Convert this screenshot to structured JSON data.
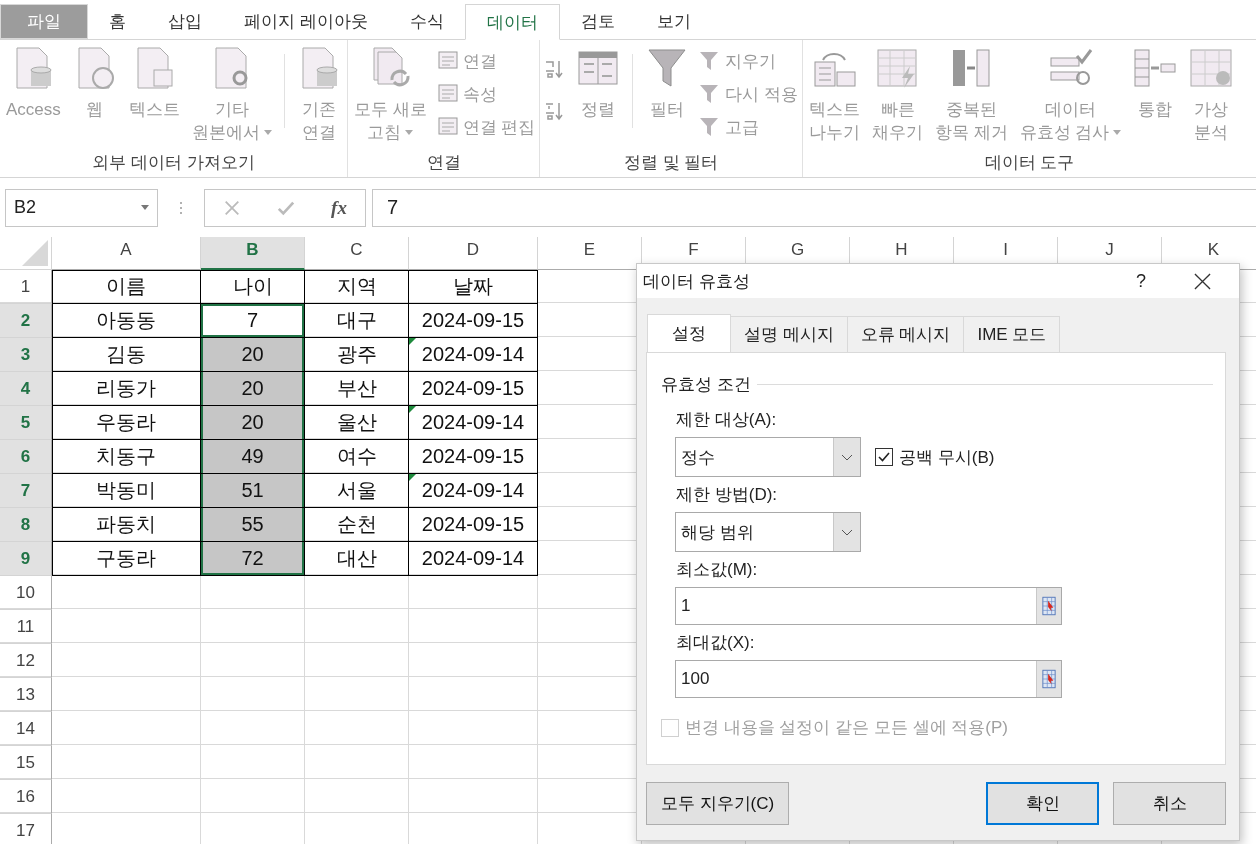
{
  "ribbon_tabs": [
    {
      "label": "파일",
      "kind": "file",
      "selected": false
    },
    {
      "label": "홈",
      "kind": "tab",
      "selected": false
    },
    {
      "label": "삽입",
      "kind": "tab",
      "selected": false
    },
    {
      "label": "페이지 레이아웃",
      "kind": "tab",
      "selected": false
    },
    {
      "label": "수식",
      "kind": "tab",
      "selected": false
    },
    {
      "label": "데이터",
      "kind": "tab",
      "selected": true
    },
    {
      "label": "검토",
      "kind": "tab",
      "selected": false
    },
    {
      "label": "보기",
      "kind": "tab",
      "selected": false
    }
  ],
  "ribbon_groups": [
    {
      "label": "외부 데이터 가져오기",
      "items": [
        {
          "kind": "large",
          "lines": [
            "Access"
          ],
          "dropdown": false
        },
        {
          "kind": "large",
          "lines": [
            "웹"
          ],
          "dropdown": false
        },
        {
          "kind": "large",
          "lines": [
            "텍스트"
          ],
          "dropdown": false
        },
        {
          "kind": "large",
          "lines": [
            "기타",
            "원본에서"
          ],
          "dropdown": true
        },
        {
          "kind": "separator"
        },
        {
          "kind": "large",
          "lines": [
            "기존",
            "연결"
          ],
          "dropdown": false
        }
      ]
    },
    {
      "label": "연결",
      "items": [
        {
          "kind": "large",
          "lines": [
            "모두 새로",
            "고침"
          ],
          "dropdown": true
        },
        {
          "kind": "column",
          "items": [
            {
              "label": "연결"
            },
            {
              "label": "속성"
            },
            {
              "label": "연결 편집"
            }
          ]
        }
      ]
    },
    {
      "label": "정렬 및 필터",
      "items": [
        {
          "kind": "sort_buttons"
        },
        {
          "kind": "large",
          "lines": [
            "정렬"
          ],
          "dropdown": false
        },
        {
          "kind": "separator"
        },
        {
          "kind": "large",
          "lines": [
            "필터"
          ],
          "dropdown": false
        },
        {
          "kind": "column",
          "items": [
            {
              "label": "지우기"
            },
            {
              "label": "다시 적용"
            },
            {
              "label": "고급"
            }
          ]
        }
      ]
    },
    {
      "label": "데이터 도구",
      "items": [
        {
          "kind": "large",
          "lines": [
            "텍스트",
            "나누기"
          ],
          "dropdown": false
        },
        {
          "kind": "large",
          "lines": [
            "빠른",
            "채우기"
          ],
          "dropdown": false
        },
        {
          "kind": "large",
          "lines": [
            "중복된",
            "항목 제거"
          ],
          "dropdown": false
        },
        {
          "kind": "large",
          "lines": [
            "데이터",
            "유효성 검사"
          ],
          "dropdown": true
        },
        {
          "kind": "large",
          "lines": [
            "통합"
          ],
          "dropdown": false
        },
        {
          "kind": "large",
          "lines": [
            "가상",
            "분석"
          ],
          "dropdown": false
        }
      ]
    }
  ],
  "formula_bar": {
    "name_box": "B2",
    "function_button": "fx",
    "value": "7"
  },
  "sheet": {
    "columns": [
      {
        "label": "A",
        "selected": false
      },
      {
        "label": "B",
        "selected": true
      },
      {
        "label": "C",
        "selected": false
      },
      {
        "label": "D",
        "selected": false
      },
      {
        "label": "E",
        "selected": false
      },
      {
        "label": "F",
        "selected": false
      },
      {
        "label": "G",
        "selected": false
      },
      {
        "label": "H",
        "selected": false
      },
      {
        "label": "I",
        "selected": false
      },
      {
        "label": "J",
        "selected": false
      },
      {
        "label": "K",
        "selected": false
      }
    ],
    "rows": [
      {
        "label": "1",
        "selected": false,
        "cells": [
          {
            "text": "이름",
            "selected": false,
            "active": false,
            "flagged": false
          },
          {
            "text": "나이",
            "selected": false,
            "active": false,
            "flagged": false
          },
          {
            "text": "지역",
            "selected": false,
            "active": false,
            "flagged": false
          },
          {
            "text": "날짜",
            "selected": false,
            "active": false,
            "flagged": false
          }
        ]
      },
      {
        "label": "2",
        "selected": true,
        "cells": [
          {
            "text": "아동동",
            "selected": false,
            "active": false,
            "flagged": false
          },
          {
            "text": "7",
            "selected": true,
            "active": true,
            "flagged": false
          },
          {
            "text": "대구",
            "selected": false,
            "active": false,
            "flagged": false
          },
          {
            "text": "2024-09-15",
            "selected": false,
            "active": false,
            "flagged": false
          }
        ]
      },
      {
        "label": "3",
        "selected": true,
        "cells": [
          {
            "text": "김동",
            "selected": false,
            "active": false,
            "flagged": false
          },
          {
            "text": "20",
            "selected": true,
            "active": false,
            "flagged": false
          },
          {
            "text": "광주",
            "selected": false,
            "active": false,
            "flagged": false
          },
          {
            "text": "2024-09-14",
            "selected": false,
            "active": false,
            "flagged": true
          }
        ]
      },
      {
        "label": "4",
        "selected": true,
        "cells": [
          {
            "text": "리동가",
            "selected": false,
            "active": false,
            "flagged": false
          },
          {
            "text": "20",
            "selected": true,
            "active": false,
            "flagged": false
          },
          {
            "text": "부산",
            "selected": false,
            "active": false,
            "flagged": false
          },
          {
            "text": "2024-09-15",
            "selected": false,
            "active": false,
            "flagged": false
          }
        ]
      },
      {
        "label": "5",
        "selected": true,
        "cells": [
          {
            "text": "우동라",
            "selected": false,
            "active": false,
            "flagged": false
          },
          {
            "text": "20",
            "selected": true,
            "active": false,
            "flagged": false
          },
          {
            "text": "울산",
            "selected": false,
            "active": false,
            "flagged": false
          },
          {
            "text": "2024-09-14",
            "selected": false,
            "active": false,
            "flagged": true
          }
        ]
      },
      {
        "label": "6",
        "selected": true,
        "cells": [
          {
            "text": "치동구",
            "selected": false,
            "active": false,
            "flagged": false
          },
          {
            "text": "49",
            "selected": true,
            "active": false,
            "flagged": false
          },
          {
            "text": "여수",
            "selected": false,
            "active": false,
            "flagged": false
          },
          {
            "text": "2024-09-15",
            "selected": false,
            "active": false,
            "flagged": false
          }
        ]
      },
      {
        "label": "7",
        "selected": true,
        "cells": [
          {
            "text": "박동미",
            "selected": false,
            "active": false,
            "flagged": false
          },
          {
            "text": "51",
            "selected": true,
            "active": false,
            "flagged": false
          },
          {
            "text": "서울",
            "selected": false,
            "active": false,
            "flagged": false
          },
          {
            "text": "2024-09-14",
            "selected": false,
            "active": false,
            "flagged": true
          }
        ]
      },
      {
        "label": "8",
        "selected": true,
        "cells": [
          {
            "text": "파동치",
            "selected": false,
            "active": false,
            "flagged": false
          },
          {
            "text": "55",
            "selected": true,
            "active": false,
            "flagged": false
          },
          {
            "text": "순천",
            "selected": false,
            "active": false,
            "flagged": false
          },
          {
            "text": "2024-09-15",
            "selected": false,
            "active": false,
            "flagged": false
          }
        ]
      },
      {
        "label": "9",
        "selected": true,
        "cells": [
          {
            "text": "구동라",
            "selected": false,
            "active": false,
            "flagged": false
          },
          {
            "text": "72",
            "selected": true,
            "active": false,
            "flagged": false
          },
          {
            "text": "대산",
            "selected": false,
            "active": false,
            "flagged": false
          },
          {
            "text": "2024-09-14",
            "selected": false,
            "active": false,
            "flagged": false
          }
        ]
      },
      {
        "label": "10",
        "selected": false
      },
      {
        "label": "11",
        "selected": false
      },
      {
        "label": "12",
        "selected": false
      },
      {
        "label": "13",
        "selected": false
      },
      {
        "label": "14",
        "selected": false
      },
      {
        "label": "15",
        "selected": false
      },
      {
        "label": "16",
        "selected": false
      },
      {
        "label": "17",
        "selected": false
      }
    ]
  },
  "dialog": {
    "title": "데이터 유효성",
    "help": "?",
    "tabs": [
      {
        "label": "설정",
        "selected": true
      },
      {
        "label": "설명 메시지",
        "selected": false
      },
      {
        "label": "오류 메시지",
        "selected": false
      },
      {
        "label": "IME 모드",
        "selected": false
      }
    ],
    "section": "유효성 조건",
    "allow": {
      "label": "제한 대상(A):",
      "value": "정수"
    },
    "ignore_blank": {
      "label": "공백 무시(B)",
      "checked": true
    },
    "data": {
      "label": "제한 방법(D):",
      "value": "해당 범위"
    },
    "minimum": {
      "label": "최소값(M):",
      "value": "1"
    },
    "maximum": {
      "label": "최대값(X):",
      "value": "100"
    },
    "apply_all": {
      "label": "변경 내용을 설정이 같은 모든 셀에 적용(P)",
      "checked": false,
      "disabled": true
    },
    "buttons": [
      {
        "label": "모두 지우기(C)",
        "kind": "left",
        "default": false
      },
      {
        "label": "확인",
        "kind": "right",
        "default": true
      },
      {
        "label": "취소",
        "kind": "right",
        "default": false
      }
    ]
  }
}
